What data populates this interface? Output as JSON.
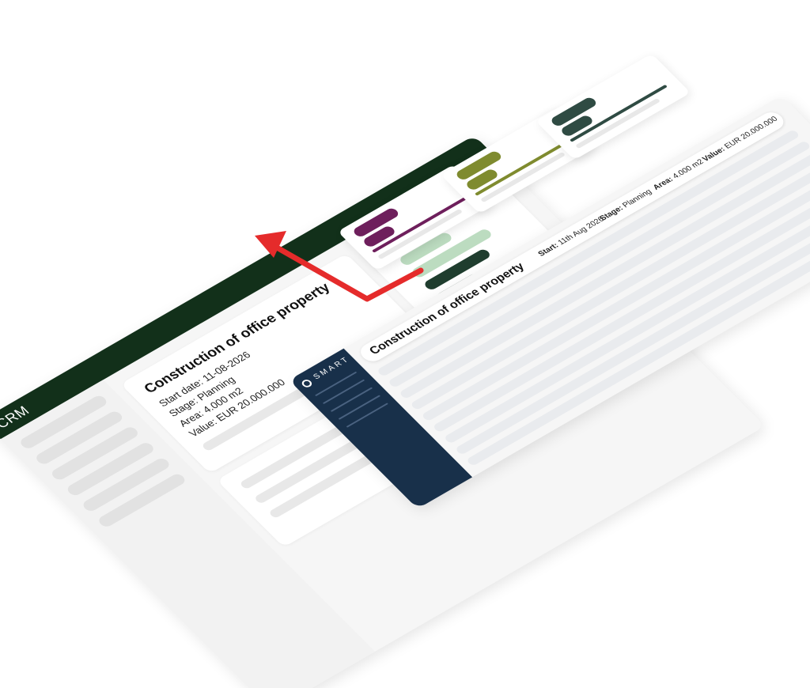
{
  "crm": {
    "title": "CRM",
    "project": {
      "name": "Construction of office property",
      "start_date": "Start date: 11-08-2026",
      "stage": "Stage: Planning",
      "area": "Area: 4.000 m2",
      "value": "Value: EUR 20.000.000"
    }
  },
  "smart": {
    "logo_text": "SMART",
    "project": {
      "name": "Construction of office property",
      "start_label": "Start:",
      "start_value": "11th Aug 2026",
      "stage_label": "Stage:",
      "stage_value": "Planning",
      "area_label": "Area:",
      "area_value": "4.000 m2",
      "value_label": "Value:",
      "value_value": "EUR 20.000.000"
    }
  },
  "colors": {
    "crm_header": "#12301a",
    "smart_sidebar": "#18304a",
    "accent_purple": "#6e1f5c",
    "accent_olive": "#7f8b2f",
    "accent_darkgreen": "#2f4b43",
    "arrow_red": "#e52b2b",
    "chart_light_green": "#bcdcc0"
  },
  "icons": {
    "window_controls": "three-dots-icon",
    "smart_logo": "circle-logo-icon",
    "sync_arrow": "arrow-left-up-icon"
  }
}
